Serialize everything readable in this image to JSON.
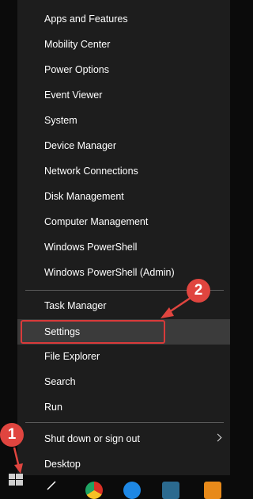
{
  "menu": {
    "group1": [
      "Apps and Features",
      "Mobility Center",
      "Power Options",
      "Event Viewer",
      "System",
      "Device Manager",
      "Network Connections",
      "Disk Management",
      "Computer Management",
      "Windows PowerShell",
      "Windows PowerShell (Admin)"
    ],
    "group2": [
      "Task Manager",
      "Settings",
      "File Explorer",
      "Search",
      "Run"
    ],
    "group3": [
      "Shut down or sign out",
      "Desktop"
    ]
  },
  "annotations": {
    "step1": "1",
    "step2": "2",
    "color": "#e0453f"
  },
  "colors": {
    "menu_bg": "#1d1d1d",
    "highlight_bg": "#3b3b3b",
    "text": "#ffffff"
  }
}
